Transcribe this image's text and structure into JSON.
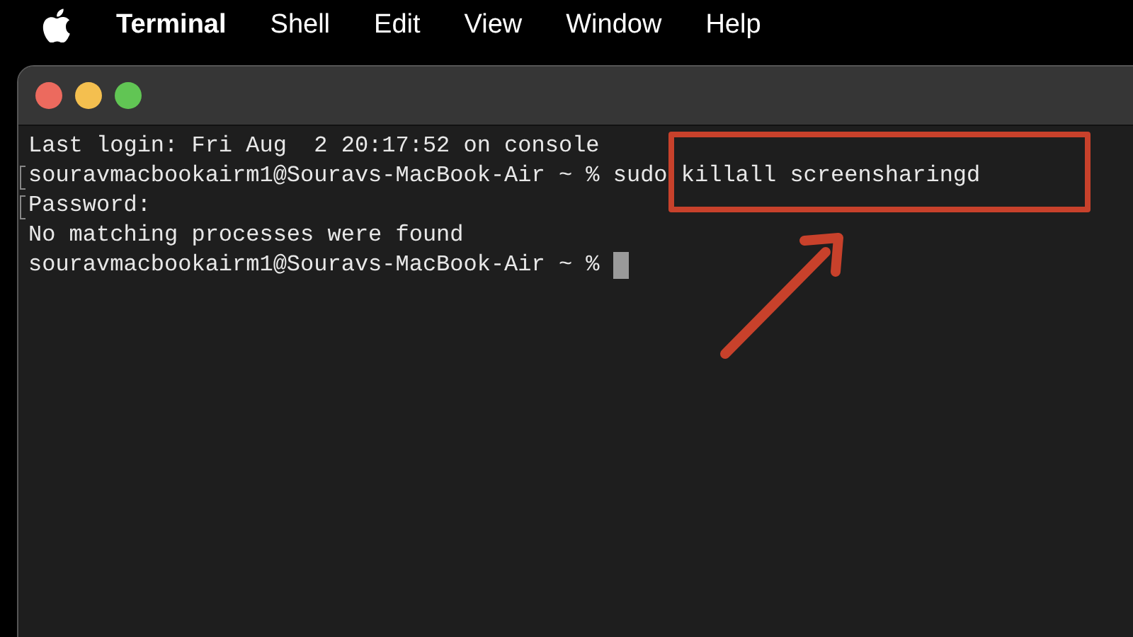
{
  "menu_bar": {
    "app_name": "Terminal",
    "items": [
      "Shell",
      "Edit",
      "View",
      "Window",
      "Help"
    ]
  },
  "terminal": {
    "lines": [
      {
        "marked": false,
        "text": "Last login: Fri Aug  2 20:17:52 on console",
        "cursor": false,
        "highlighted": false
      },
      {
        "marked": true,
        "prompt": "souravmacbookairm1@Souravs-MacBook-Air ~ % ",
        "text": "sudo killall screensharingd",
        "cursor": false,
        "highlighted": true
      },
      {
        "marked": true,
        "text": "Password:",
        "cursor": false,
        "highlighted": false
      },
      {
        "marked": false,
        "text": "No matching processes were found",
        "cursor": false,
        "highlighted": false
      },
      {
        "marked": false,
        "prompt": "souravmacbookairm1@Souravs-MacBook-Air ~ % ",
        "cursor": true,
        "highlighted": false
      }
    ]
  },
  "annotation": {
    "arrow": true
  }
}
